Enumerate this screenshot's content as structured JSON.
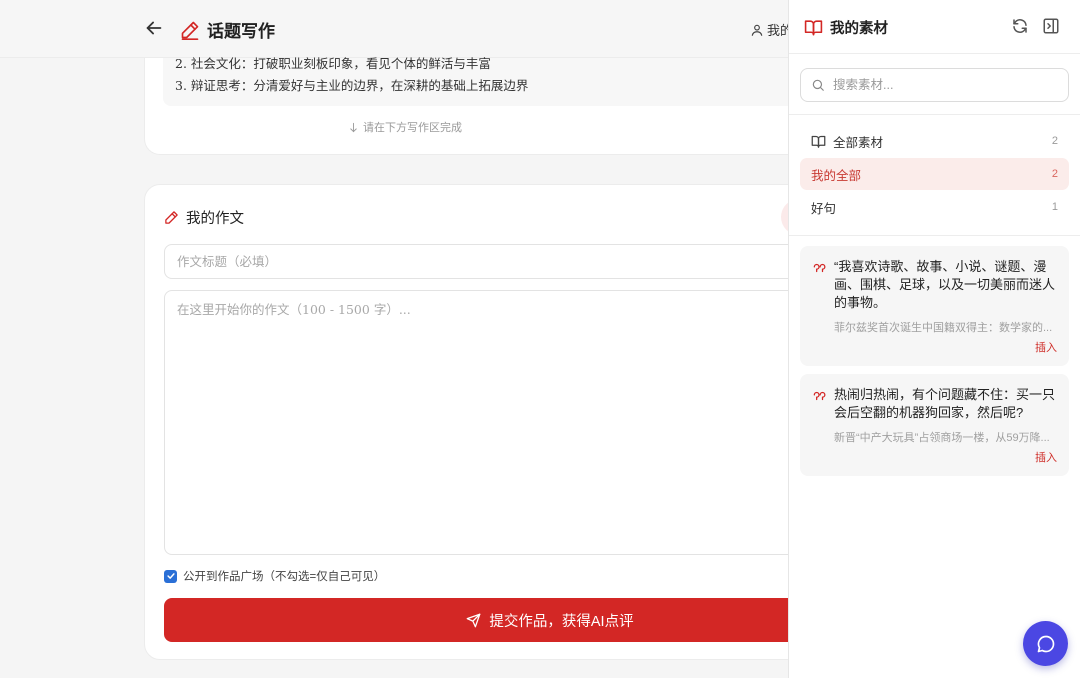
{
  "header": {
    "title": "话题写作",
    "user_label": "我的"
  },
  "topic": {
    "points": [
      "2. 社会文化：打破职业刻板印象，看见个体的鲜活与丰富",
      "3. 辩证思考：分清爱好与主业的边界，在深耕的基础上拓展边界"
    ],
    "hint": "请在下方写作区完成"
  },
  "essay": {
    "heading": "我的作文",
    "title_placeholder": "作文标题（必填）",
    "body_placeholder": "在这里开始你的作文（100 - 1500 字）...",
    "public_label": "公开到作品广场（不勾选=仅自己可见）",
    "public_checked": true,
    "submit_label": "提交作品，获得AI点评"
  },
  "panel": {
    "title": "我的素材",
    "search_placeholder": "搜索素材...",
    "categories": [
      {
        "label": "全部素材",
        "count": "2"
      },
      {
        "label": "我的全部",
        "count": "2"
      },
      {
        "label": "好句",
        "count": "1"
      }
    ],
    "materials": [
      {
        "text": "“我喜欢诗歌、故事、小说、谜题、漫画、围棋、足球，以及一切美丽而迷人的事物。",
        "source": "菲尔兹奖首次诞生中国籍双得主：数学家的...",
        "action": "插入"
      },
      {
        "text": "热闹归热闹，有个问题藏不住：买一只会后空翻的机器狗回家，然后呢?",
        "source": "新晋“中产大玩具”占领商场一楼，从59万降...",
        "action": "插入"
      }
    ]
  },
  "colors": {
    "brand_red": "#d32725",
    "fab_purple": "#4b47e3",
    "active_bg": "#fbecea"
  },
  "icons": {
    "back": "arrow-left-icon",
    "pen": "pen-icon",
    "user": "user-icon",
    "book": "book-open-icon",
    "refresh": "refresh-icon",
    "collapse": "panel-collapse-icon",
    "search": "search-icon",
    "quote": "quote-icon",
    "send": "send-icon",
    "chat": "chat-icon"
  }
}
